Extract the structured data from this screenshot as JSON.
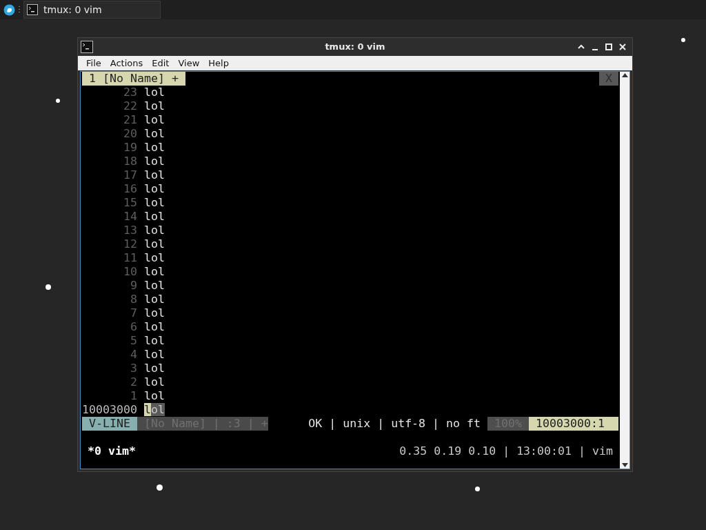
{
  "taskbar": {
    "items": [
      {
        "label": "tmux: 0 vim",
        "selected": true
      }
    ]
  },
  "window": {
    "title": "tmux: 0 vim"
  },
  "menu": [
    "File",
    "Actions",
    "Edit",
    "View",
    "Help"
  ],
  "vim": {
    "tabline": {
      "tab": "1 [No Name] +",
      "close": "X"
    },
    "lines": [
      {
        "number": "23",
        "text": "lol",
        "current": false
      },
      {
        "number": "22",
        "text": "lol",
        "current": false
      },
      {
        "number": "21",
        "text": "lol",
        "current": false
      },
      {
        "number": "20",
        "text": "lol",
        "current": false
      },
      {
        "number": "19",
        "text": "lol",
        "current": false
      },
      {
        "number": "18",
        "text": "lol",
        "current": false
      },
      {
        "number": "17",
        "text": "lol",
        "current": false
      },
      {
        "number": "16",
        "text": "lol",
        "current": false
      },
      {
        "number": "15",
        "text": "lol",
        "current": false
      },
      {
        "number": "14",
        "text": "lol",
        "current": false
      },
      {
        "number": "13",
        "text": "lol",
        "current": false
      },
      {
        "number": "12",
        "text": "lol",
        "current": false
      },
      {
        "number": "11",
        "text": "lol",
        "current": false
      },
      {
        "number": "10",
        "text": "lol",
        "current": false
      },
      {
        "number": "9",
        "text": "lol",
        "current": false
      },
      {
        "number": "8",
        "text": "lol",
        "current": false
      },
      {
        "number": "7",
        "text": "lol",
        "current": false
      },
      {
        "number": "6",
        "text": "lol",
        "current": false
      },
      {
        "number": "5",
        "text": "lol",
        "current": false
      },
      {
        "number": "4",
        "text": "lol",
        "current": false
      },
      {
        "number": "3",
        "text": "lol",
        "current": false
      },
      {
        "number": "2",
        "text": "lol",
        "current": false
      },
      {
        "number": "1",
        "text": "lol",
        "current": false
      },
      {
        "number": "10003000",
        "text": "lol",
        "current": true
      }
    ],
    "statusline": {
      "mode": "V-LINE",
      "file": "[No Name] | :3 | +",
      "info": "OK | unix | utf-8 | no ft",
      "percent": "100%",
      "position": "10003000:1"
    }
  },
  "tmux": {
    "window": "*0 vim*",
    "status": "0.35 0.19 0.10 | 13:00:01 | vim"
  }
}
